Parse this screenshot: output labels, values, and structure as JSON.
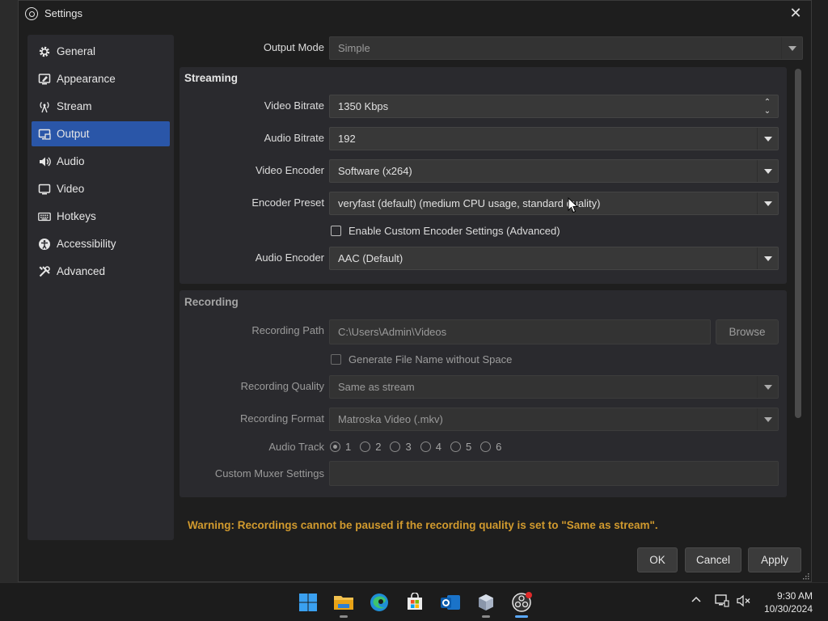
{
  "window": {
    "title": "Settings"
  },
  "sidebar": {
    "items": [
      {
        "label": "General",
        "icon": "gear-icon"
      },
      {
        "label": "Appearance",
        "icon": "appearance-icon"
      },
      {
        "label": "Stream",
        "icon": "antenna-icon"
      },
      {
        "label": "Output",
        "icon": "monitor-output-icon",
        "active": true
      },
      {
        "label": "Audio",
        "icon": "speaker-icon"
      },
      {
        "label": "Video",
        "icon": "monitor-icon"
      },
      {
        "label": "Hotkeys",
        "icon": "keyboard-icon"
      },
      {
        "label": "Accessibility",
        "icon": "accessibility-icon"
      },
      {
        "label": "Advanced",
        "icon": "tools-icon"
      }
    ]
  },
  "output": {
    "mode_label": "Output Mode",
    "mode_value": "Simple",
    "streaming": {
      "title": "Streaming",
      "video_bitrate_label": "Video Bitrate",
      "video_bitrate_value": "1350 Kbps",
      "audio_bitrate_label": "Audio Bitrate",
      "audio_bitrate_value": "192",
      "video_encoder_label": "Video Encoder",
      "video_encoder_value": "Software (x264)",
      "encoder_preset_label": "Encoder Preset",
      "encoder_preset_value": "veryfast (default) (medium CPU usage, standard quality)",
      "custom_settings_label": "Enable Custom Encoder Settings (Advanced)",
      "audio_encoder_label": "Audio Encoder",
      "audio_encoder_value": "AAC (Default)"
    },
    "recording": {
      "title": "Recording",
      "path_label": "Recording Path",
      "path_value": "C:\\Users\\Admin\\Videos",
      "browse_label": "Browse",
      "no_space_label": "Generate File Name without Space",
      "quality_label": "Recording Quality",
      "quality_value": "Same as stream",
      "format_label": "Recording Format",
      "format_value": "Matroska Video (.mkv)",
      "audio_track_label": "Audio Track",
      "tracks": [
        "1",
        "2",
        "3",
        "4",
        "5",
        "6"
      ],
      "muxer_label": "Custom Muxer Settings",
      "muxer_value": ""
    },
    "warning": "Warning: Recordings cannot be paused if the recording quality is set to \"Same as stream\"."
  },
  "buttons": {
    "ok": "OK",
    "cancel": "Cancel",
    "apply": "Apply"
  },
  "taskbar": {
    "time": "9:30 AM",
    "date": "10/30/2024"
  },
  "colors": {
    "accent": "#2a56a8",
    "warning": "#d19a2e"
  }
}
